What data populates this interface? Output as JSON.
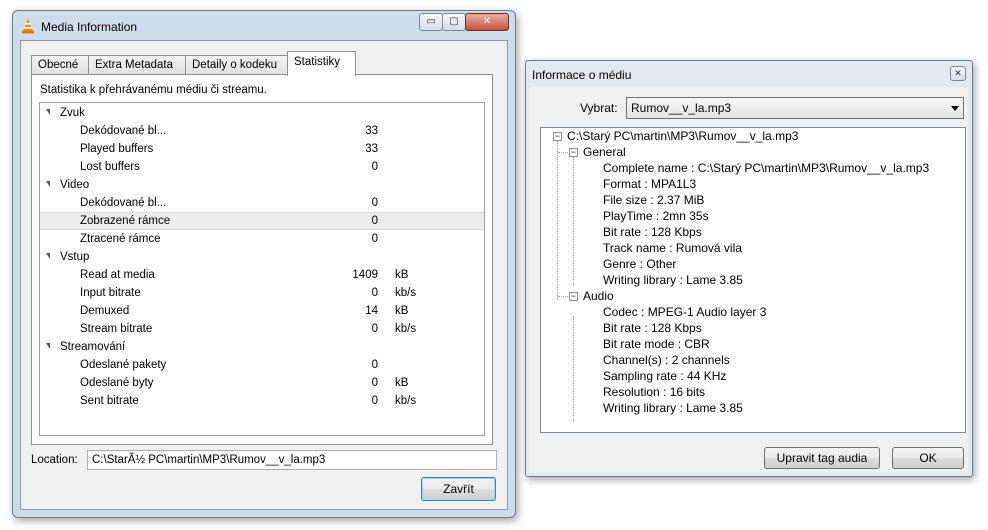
{
  "vlc": {
    "title": "Media Information",
    "controls": {
      "minimize": "▭",
      "maximize": "▢",
      "close": "✕"
    },
    "tabs": [
      {
        "label": "Obecné"
      },
      {
        "label": "Extra Metadata"
      },
      {
        "label": "Detaily o kodeku"
      },
      {
        "label": "Statistiky"
      }
    ],
    "active_tab": "Statistiky",
    "description": "Statistika k přehrávanému médiu či streamu.",
    "stats": {
      "zvuk": {
        "label": "Zvuk",
        "rows": [
          {
            "label": "Dekódované bl...",
            "value": "33",
            "unit": ""
          },
          {
            "label": "Played buffers",
            "value": "33",
            "unit": ""
          },
          {
            "label": "Lost buffers",
            "value": "0",
            "unit": ""
          }
        ]
      },
      "video": {
        "label": "Video",
        "rows": [
          {
            "label": "Dekódované bl...",
            "value": "0",
            "unit": ""
          },
          {
            "label": "Zobrazené rámce",
            "value": "0",
            "unit": ""
          },
          {
            "label": "Ztracené rámce",
            "value": "0",
            "unit": ""
          }
        ]
      },
      "vstup": {
        "label": "Vstup",
        "rows": [
          {
            "label": "Read at media",
            "value": "1409",
            "unit": "kB"
          },
          {
            "label": "Input bitrate",
            "value": "0",
            "unit": "kb/s"
          },
          {
            "label": "Demuxed",
            "value": "14",
            "unit": "kB"
          },
          {
            "label": "Stream bitrate",
            "value": "0",
            "unit": "kb/s"
          }
        ]
      },
      "streamovani": {
        "label": "Streamování",
        "rows": [
          {
            "label": "Odeslané pakety",
            "value": "0",
            "unit": ""
          },
          {
            "label": "Odeslané byty",
            "value": "0",
            "unit": "kB"
          },
          {
            "label": "Sent bitrate",
            "value": "0",
            "unit": "kb/s"
          }
        ]
      }
    },
    "location_label": "Location:",
    "location_value": "C:\\StarÃ½ PC\\martin\\MP3\\Rumov__v_la.mp3",
    "close_button": "Zavřít"
  },
  "info": {
    "title": "Informace o médiu",
    "close_glyph": "✕",
    "select_label": "Vybrat:",
    "select_value": "Rumov__v_la.mp3",
    "root": "C:\\Starý PC\\martin\\MP3\\Rumov__v_la.mp3",
    "general": {
      "label": "General",
      "items": [
        "Complete name : C:\\Starý PC\\martin\\MP3\\Rumov__v_la.mp3",
        "Format : MPA1L3",
        "File size : 2.37 MiB",
        "PlayTime : 2mn 35s",
        "Bit rate : 128 Kbps",
        "Track name : Rumová vila",
        "Genre : Other",
        "Writing library : Lame 3.85"
      ]
    },
    "audio": {
      "label": "Audio",
      "items": [
        "Codec : MPEG-1 Audio layer 3",
        "Bit rate : 128 Kbps",
        "Bit rate mode : CBR",
        "Channel(s) : 2 channels",
        "Sampling rate : 44 KHz",
        "Resolution : 16 bits",
        "Writing library : Lame 3.85"
      ]
    },
    "edit_button": "Upravit tag audia",
    "ok_button": "OK",
    "expander_glyph": "−"
  }
}
